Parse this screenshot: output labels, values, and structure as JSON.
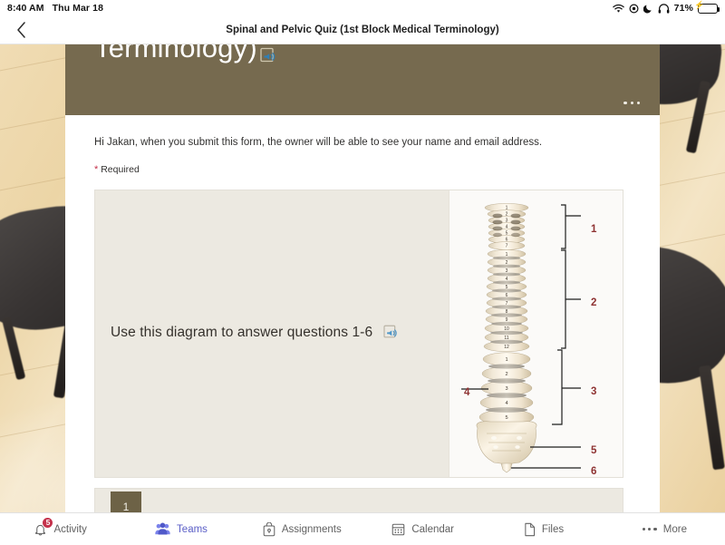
{
  "status_bar": {
    "time": "8:40 AM",
    "date": "Thu Mar 18",
    "battery_percent": "71%",
    "icons": [
      "wifi-icon",
      "location-icon",
      "moon-icon",
      "headphones-icon",
      "battery-charging-icon"
    ]
  },
  "nav": {
    "back_icon": "chevron-left-icon",
    "title": "Spinal and Pelvic Quiz (1st Block Medical Terminology)"
  },
  "form": {
    "banner_title_visible": "Terminology)",
    "banner_color": "#766a4f",
    "reader_icon": "immersive-reader-icon",
    "overflow_icon": "more-horizontal-icon",
    "greeting": "Hi Jakan, when you submit this form, the owner will be able to see your name and email address.",
    "required_asterisk": "*",
    "required_label": "Required"
  },
  "question_card": {
    "text": "Use this diagram to answer questions 1-6",
    "reader_icon": "immersive-reader-icon",
    "image_alt": "spine-diagram"
  },
  "next_card": {
    "number": "1"
  },
  "diagram": {
    "label_color": "#8e3232",
    "callouts": [
      {
        "id": "1",
        "region": "cervical"
      },
      {
        "id": "2",
        "region": "thoracic"
      },
      {
        "id": "3",
        "region": "lumbar"
      },
      {
        "id": "4",
        "region": "lumbar-vertebra"
      },
      {
        "id": "5",
        "region": "sacrum"
      },
      {
        "id": "6",
        "region": "coccyx"
      }
    ],
    "cervical_numbers": [
      "1",
      "2",
      "3",
      "4",
      "5",
      "6",
      "7"
    ],
    "thoracic_numbers": [
      "1",
      "2",
      "3",
      "4",
      "5",
      "6",
      "7",
      "8",
      "9",
      "10",
      "11",
      "12"
    ],
    "lumbar_numbers": [
      "1",
      "2",
      "3",
      "4",
      "5"
    ]
  },
  "tabbar": {
    "active_index": 1,
    "accent": "#5b5fc7",
    "items": [
      {
        "label": "Activity",
        "icon": "bell-icon",
        "badge": "5"
      },
      {
        "label": "Teams",
        "icon": "people-icon",
        "badge": ""
      },
      {
        "label": "Assignments",
        "icon": "assignments-icon",
        "badge": ""
      },
      {
        "label": "Calendar",
        "icon": "calendar-icon",
        "badge": ""
      },
      {
        "label": "Files",
        "icon": "file-icon",
        "badge": ""
      },
      {
        "label": "More",
        "icon": "more-horizontal-icon",
        "badge": ""
      }
    ]
  }
}
